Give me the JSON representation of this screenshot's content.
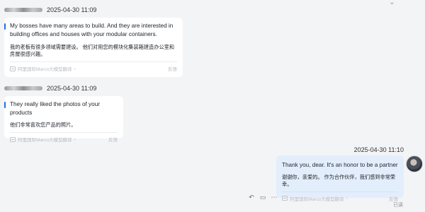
{
  "messages": [
    {
      "sender_redacted": true,
      "time": "2025-04-30 11:09",
      "original": "My bosses have many areas to build. And they are interested in building offices and houses with your modular containers.",
      "translated": "我的老板有很多领域需要建设。 他们对用您的模块化集装箱建造办公室和房屋很感兴趣。",
      "translator": "阿里国际Marco大模型翻译",
      "feedback": "反馈"
    },
    {
      "sender_redacted": true,
      "time": "2025-04-30 11:09",
      "original": "They really liked the photos of your products",
      "translated": "他们非常喜欢您产品的照片。",
      "translator": "阿里国际Marco大模型翻译",
      "feedback": "反馈"
    },
    {
      "time": "2025-04-30 11:10",
      "original": "Thank you, dear. It's an honor to be a partner",
      "translated": "谢谢你，亲爱的。 作为合作伙伴，我们感到非常荣幸。",
      "translator": "阿里国际Marco大模型翻译",
      "feedback": "反馈",
      "status": "已读"
    }
  ]
}
